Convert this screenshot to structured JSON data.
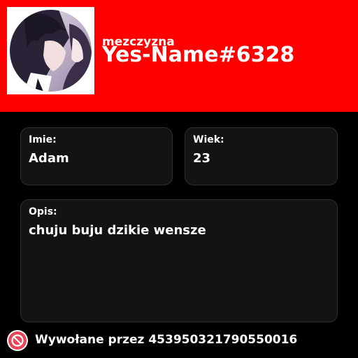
{
  "header": {
    "gender": "mezczyzna",
    "username": "Yes-Name#6328",
    "avatar_icon": "anime-avatar-icon",
    "background_color": "#fe0000"
  },
  "fields": {
    "name": {
      "label": "Imie:",
      "value": "Adam"
    },
    "age": {
      "label": "Wiek:",
      "value": "23"
    },
    "description": {
      "label": "Opis:",
      "value": "chuju buju dzikie wensze"
    }
  },
  "footer": {
    "icon": "no-sign-icon",
    "invoked_by": "Wywołane przez 453950321790550016"
  }
}
